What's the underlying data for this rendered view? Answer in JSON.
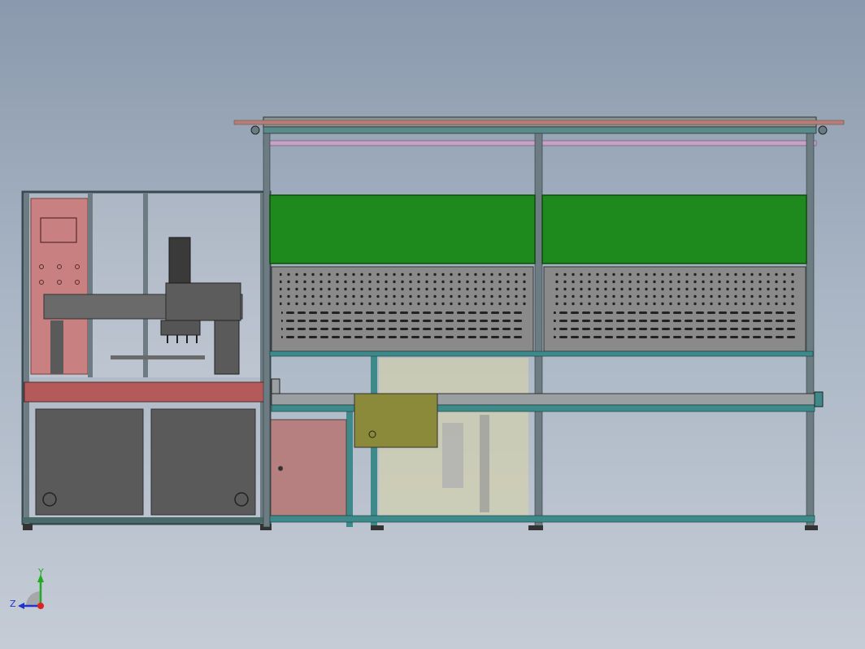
{
  "viewport": {
    "background_top": "#8a99ad",
    "background_bottom": "#c5ccd6"
  },
  "colors": {
    "frame": "#7b8a93",
    "frame_dark": "#3a4a52",
    "teal": "#3e8a8a",
    "red_panel": "#c98080",
    "red_bar": "#b45a5a",
    "green_panel": "#1e8a1e",
    "perforated": "#8a8a8a",
    "dark_panel": "#5a5a5a",
    "olive": "#8a8a3a",
    "cabinet": "#b68080",
    "pink_rail": "#c8a0c8"
  },
  "triad": {
    "y_label": "Y",
    "z_label": "Z",
    "y_color": "#22aa22",
    "z_color": "#2233cc",
    "origin_color": "#dd2222"
  }
}
